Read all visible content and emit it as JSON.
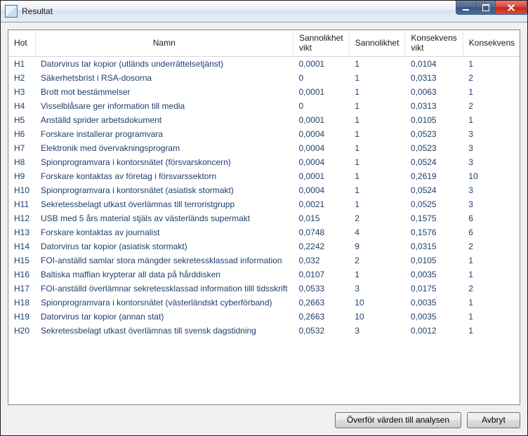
{
  "window": {
    "title": "Resultat"
  },
  "columns": {
    "hot": "Hot",
    "namn": "Namn",
    "sannolikhet_vikt": "Sannolikhet vikt",
    "sannolikhet": "Sannolikhet",
    "konsekvens_vikt": "Konsekvens vikt",
    "konsekvens": "Konsekvens"
  },
  "rows": [
    {
      "hot": "H1",
      "namn": "Datorvirus tar kopior (utländs underrättelsetjänst)",
      "sv": "0,0001",
      "s": "1",
      "kv": "0,0104",
      "k": "1"
    },
    {
      "hot": "H2",
      "namn": "Säkerhetsbrist i RSA-dosorna",
      "sv": "0",
      "s": "1",
      "kv": "0,0313",
      "k": "2"
    },
    {
      "hot": "H3",
      "namn": "Brott mot bestämmelser",
      "sv": "0,0001",
      "s": "1",
      "kv": "0,0063",
      "k": "1"
    },
    {
      "hot": "H4",
      "namn": "Visselblåsare ger information till media",
      "sv": "0",
      "s": "1",
      "kv": "0,0313",
      "k": "2"
    },
    {
      "hot": "H5",
      "namn": "Anställd sprider arbetsdokument",
      "sv": "0,0001",
      "s": "1",
      "kv": "0,0105",
      "k": "1"
    },
    {
      "hot": "H6",
      "namn": "Forskare installerar programvara",
      "sv": "0,0004",
      "s": "1",
      "kv": "0,0523",
      "k": "3"
    },
    {
      "hot": "H7",
      "namn": "Elektronik med övervakningsprogram",
      "sv": "0,0004",
      "s": "1",
      "kv": "0,0523",
      "k": "3"
    },
    {
      "hot": "H8",
      "namn": "Spionprogramvara i kontorsnätet (försvarskoncern)",
      "sv": "0,0004",
      "s": "1",
      "kv": "0,0524",
      "k": "3"
    },
    {
      "hot": "H9",
      "namn": "Forskare kontaktas av företag i försvarssektorn",
      "sv": "0,0001",
      "s": "1",
      "kv": "0,2619",
      "k": "10"
    },
    {
      "hot": "H10",
      "namn": "Spionprogramvara i kontorsnätet (asiatisk stormakt)",
      "sv": "0,0004",
      "s": "1",
      "kv": "0,0524",
      "k": "3"
    },
    {
      "hot": "H11",
      "namn": "Sekretessbelagt utkast överlämnas till terroristgrupp",
      "sv": "0,0021",
      "s": "1",
      "kv": "0,0525",
      "k": "3"
    },
    {
      "hot": "H12",
      "namn": "USB med 5 års material stjäls av västerländs supermakt",
      "sv": "0,015",
      "s": "2",
      "kv": "0,1575",
      "k": "6"
    },
    {
      "hot": "H13",
      "namn": "Forskare kontaktas av journalist",
      "sv": "0,0748",
      "s": "4",
      "kv": "0,1576",
      "k": "6"
    },
    {
      "hot": "H14",
      "namn": "Datorvirus tar kopior (asiatisk stormakt)",
      "sv": "0,2242",
      "s": "9",
      "kv": "0,0315",
      "k": "2"
    },
    {
      "hot": "H15",
      "namn": "FOI-anställd samlar stora mängder sekretessklassad information",
      "sv": "0,032",
      "s": "2",
      "kv": "0,0105",
      "k": "1"
    },
    {
      "hot": "H16",
      "namn": "Baltiska maffian krypterar all data på hårddisken",
      "sv": "0,0107",
      "s": "1",
      "kv": "0,0035",
      "k": "1"
    },
    {
      "hot": "H17",
      "namn": "FOI-anställd överlämnar sekretessklassad information tilll tidsskrift",
      "sv": "0,0533",
      "s": "3",
      "kv": "0,0175",
      "k": "2"
    },
    {
      "hot": "H18",
      "namn": "Spionprogramvara i kontorsnätet (västerländskt cyberförband)",
      "sv": "0,2663",
      "s": "10",
      "kv": "0,0035",
      "k": "1"
    },
    {
      "hot": "H19",
      "namn": "Datorvirus tar kopior (annan stat)",
      "sv": "0,2663",
      "s": "10",
      "kv": "0,0035",
      "k": "1"
    },
    {
      "hot": "H20",
      "namn": "Sekretessbelagt utkast överlämnas till svensk dagstidning",
      "sv": "0,0532",
      "s": "3",
      "kv": "0,0012",
      "k": "1"
    }
  ],
  "buttons": {
    "transfer": "Överför värden till analysen",
    "cancel": "Avbryt"
  }
}
